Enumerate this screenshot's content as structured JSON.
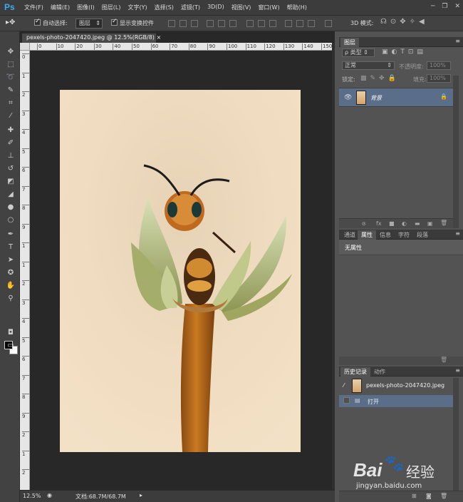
{
  "app": {
    "logo": "Ps"
  },
  "menu": [
    "文件(F)",
    "编辑(E)",
    "图像(I)",
    "图层(L)",
    "文字(Y)",
    "选择(S)",
    "滤镜(T)",
    "3D(D)",
    "视图(V)",
    "窗口(W)",
    "帮助(H)"
  ],
  "window_controls": {
    "minimize": "─",
    "restore": "❐",
    "close": "✕"
  },
  "options": {
    "auto_select_label": "自动选择:",
    "auto_select_value": "图层",
    "show_transform_label": "显示变换控件",
    "mode_3d_label": "3D 模式:"
  },
  "document": {
    "tab_title": "pexels-photo-2047420.jpeg @ 12.5%(RGB/8)",
    "tab_close": "×",
    "ruler_h_ticks": [
      "0",
      "10",
      "20",
      "30",
      "40",
      "50",
      "60",
      "70",
      "80",
      "90",
      "100",
      "110",
      "120",
      "130",
      "140",
      "150"
    ],
    "ruler_v_ticks": [
      "0",
      "1",
      "2",
      "3",
      "4",
      "5",
      "6",
      "7",
      "8",
      "9",
      "1",
      "1",
      "2",
      "3",
      "4",
      "5",
      "6",
      "7",
      "8",
      "9",
      "2",
      "1",
      "2"
    ],
    "zoom": "12.5%",
    "doc_size": "文档:68.7M/68.7M"
  },
  "layers_panel": {
    "tab": "图层",
    "filter_label": "ρ 类型",
    "blend_mode": "正常",
    "opacity_label": "不透明度:",
    "opacity_value": "100%",
    "lock_label": "锁定:",
    "fill_label": "填充:",
    "fill_value": "100%",
    "layer_name": "背景",
    "footer_icons": [
      "ɞ",
      "fx",
      "■",
      "◐",
      "▬",
      "▣",
      "🗑"
    ]
  },
  "properties_panel": {
    "tabs": [
      "通道",
      "属性",
      "信息",
      "字符",
      "段落"
    ],
    "active_tab": "属性",
    "content": "无属性"
  },
  "history_panel": {
    "tabs": [
      "历史记录",
      "动作"
    ],
    "snapshot_name": "pexels-photo-2047420.jpeg",
    "step_label": "打开"
  },
  "watermark": {
    "brand": "Bai",
    "brand2": "经验",
    "url": "jingyan.baidu.com"
  },
  "colors": {
    "accent": "#3fa9f5",
    "selected_layer": "#5a6e8a",
    "bee_orange": "#c87a22"
  }
}
